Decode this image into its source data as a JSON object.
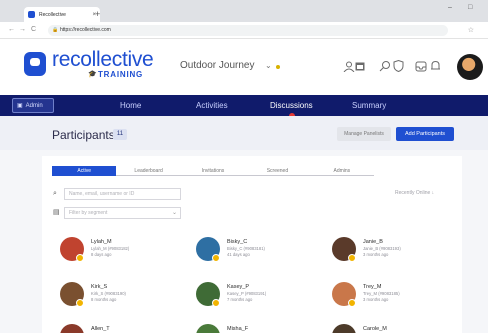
{
  "browser": {
    "tab_title": "Recollective",
    "tab_close": "×",
    "new_tab": "+",
    "minimize": "–",
    "restore": "□",
    "url": "https://recollective.com",
    "back": "←",
    "forward": "→",
    "reload": "C",
    "bookmark": "☆"
  },
  "brand": {
    "name": "recollective",
    "sub": "TRAINING",
    "accent": "#1f4fd1",
    "nav_bg": "#101b6b"
  },
  "project": {
    "name": "Outdoor Journey",
    "chevron": "⌄"
  },
  "nav": {
    "admin_label": "Admin",
    "items": [
      "Home",
      "Activities",
      "Discussions",
      "Summary"
    ],
    "active": "Discussions"
  },
  "participants": {
    "title": "Participants",
    "count": "11",
    "manage_label": "Manage Panelists",
    "add_label": "Add Participants"
  },
  "subtabs": [
    "Active",
    "Leaderboard",
    "Invitations",
    "Screened",
    "Admins"
  ],
  "search": {
    "placeholder": "Name, email, username or ID",
    "segment_placeholder": "Filter by segment"
  },
  "recent_label": "Recently Online ↓",
  "people": [
    {
      "name": "Lylah_M",
      "meta": "Lylah_M (#9083182)",
      "time": "8 days ago",
      "avatar_color": "#c0432f",
      "badge": "#f2b400"
    },
    {
      "name": "Bisky_C",
      "meta": "Bisky_C (#9083181)",
      "time": "41 days ago",
      "avatar_color": "#2e6fa3",
      "badge": "#f2b400"
    },
    {
      "name": "Janie_B",
      "meta": "Janie_B (#9083193)",
      "time": "3 months ago",
      "avatar_color": "#5a3a2a",
      "badge": "#f2b400"
    },
    {
      "name": "Kirk_S",
      "meta": "Kirk_S (#9083190)",
      "time": "8 months ago",
      "avatar_color": "#7a5030",
      "badge": "#f2b400"
    },
    {
      "name": "Kasey_P",
      "meta": "Kasey_P (#9083191)",
      "time": "7 months ago",
      "avatar_color": "#3f6b36",
      "badge": "#f2b400"
    },
    {
      "name": "Trey_M",
      "meta": "Trey_M (#9083185)",
      "time": "3 months ago",
      "avatar_color": "#c9774a",
      "badge": "#f2b400"
    },
    {
      "name": "Allen_T",
      "meta": "",
      "time": "",
      "avatar_color": "#8a3a2a",
      "badge": "#f2b400"
    },
    {
      "name": "Misha_F",
      "meta": "",
      "time": "",
      "avatar_color": "#4a7a3a",
      "badge": "#f2b400"
    },
    {
      "name": "Carole_M",
      "meta": "",
      "time": "",
      "avatar_color": "#4d3b2a",
      "badge": "#f2b400"
    }
  ]
}
